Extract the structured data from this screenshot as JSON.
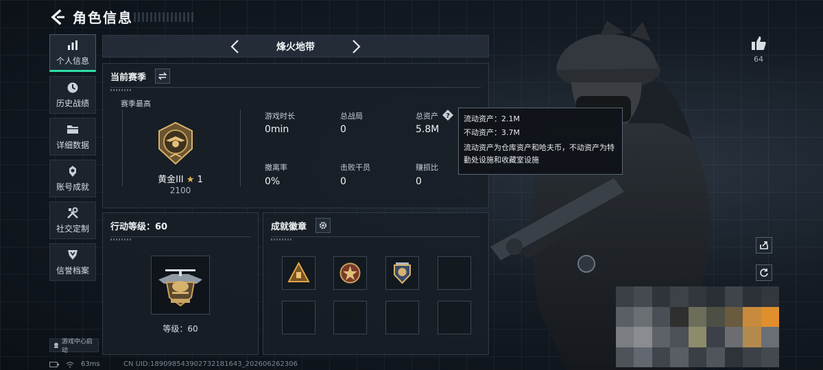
{
  "header": {
    "title": "角色信息"
  },
  "sidebar": {
    "items": [
      {
        "label": "个人信息",
        "icon": "bar-chart-icon",
        "active": true
      },
      {
        "label": "历史战绩",
        "icon": "clock-icon"
      },
      {
        "label": "详细数据",
        "icon": "folder-icon"
      },
      {
        "label": "账号成就",
        "icon": "achievement-icon"
      },
      {
        "label": "社交定制",
        "icon": "tools-icon"
      },
      {
        "label": "信誉档案",
        "icon": "shield-icon"
      }
    ],
    "launch_label": "游戏中心启动"
  },
  "modebar": {
    "mode": "烽火地带"
  },
  "season": {
    "title": "当前赛季",
    "best_label": "赛季最高",
    "rank_name": "黄金III",
    "rank_stars": "1",
    "rank_score": "2100",
    "stats": [
      {
        "label": "游戏时长",
        "value": "0min"
      },
      {
        "label": "总战局",
        "value": "0"
      },
      {
        "label": "总资产",
        "value": "5.8M"
      },
      {
        "label": "撤离率",
        "value": "0%"
      },
      {
        "label": "击败干员",
        "value": "0"
      },
      {
        "label": "赚损比",
        "value": "0"
      }
    ]
  },
  "tooltip": {
    "liquid": "流动资产：2.1M",
    "fixed": "不动资产：3.7M",
    "desc": "流动资产为仓库资产和哈夫币，不动资产为特勤处设施和收藏室设施"
  },
  "level": {
    "title": "行动等级：60",
    "level_label": "等级：60"
  },
  "badges": {
    "title": "成就徽章"
  },
  "right": {
    "likes": "64"
  },
  "status": {
    "ping": "63ms",
    "uid": "CN UID:1890985439027321816​43_202606262306"
  },
  "colors": {
    "accent": "#2fe0a8",
    "gold": "#c9a25a",
    "panel": "#181f27"
  }
}
